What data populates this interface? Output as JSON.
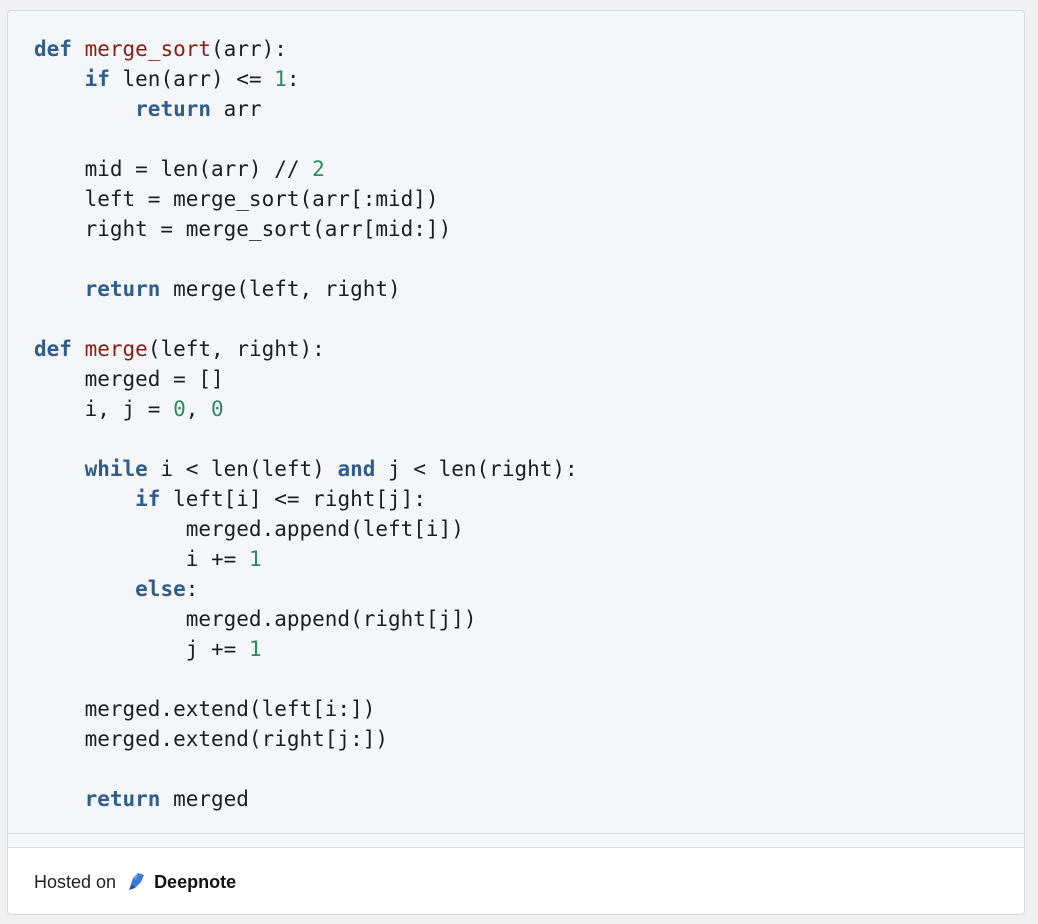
{
  "code": {
    "lines": [
      [
        [
          "kw",
          "def"
        ],
        [
          "t",
          " "
        ],
        [
          "fn",
          "merge_sort"
        ],
        [
          "t",
          "(arr):"
        ]
      ],
      [
        [
          "t",
          "    "
        ],
        [
          "kw",
          "if"
        ],
        [
          "t",
          " len(arr) <= "
        ],
        [
          "num",
          "1"
        ],
        [
          "t",
          ":"
        ]
      ],
      [
        [
          "t",
          "        "
        ],
        [
          "kw",
          "return"
        ],
        [
          "t",
          " arr"
        ]
      ],
      [
        [
          "t",
          ""
        ]
      ],
      [
        [
          "t",
          "    mid = len(arr) // "
        ],
        [
          "num",
          "2"
        ]
      ],
      [
        [
          "t",
          "    left = merge_sort(arr[:mid])"
        ]
      ],
      [
        [
          "t",
          "    right = merge_sort(arr[mid:])"
        ]
      ],
      [
        [
          "t",
          ""
        ]
      ],
      [
        [
          "t",
          "    "
        ],
        [
          "kw",
          "return"
        ],
        [
          "t",
          " merge(left, right)"
        ]
      ],
      [
        [
          "t",
          ""
        ]
      ],
      [
        [
          "kw",
          "def"
        ],
        [
          "t",
          " "
        ],
        [
          "fn",
          "merge"
        ],
        [
          "t",
          "(left, right):"
        ]
      ],
      [
        [
          "t",
          "    merged = []"
        ]
      ],
      [
        [
          "t",
          "    i, j = "
        ],
        [
          "num",
          "0"
        ],
        [
          "t",
          ", "
        ],
        [
          "num",
          "0"
        ]
      ],
      [
        [
          "t",
          ""
        ]
      ],
      [
        [
          "t",
          "    "
        ],
        [
          "kw",
          "while"
        ],
        [
          "t",
          " i < len(left) "
        ],
        [
          "kw",
          "and"
        ],
        [
          "t",
          " j < len(right):"
        ]
      ],
      [
        [
          "t",
          "        "
        ],
        [
          "kw",
          "if"
        ],
        [
          "t",
          " left[i] <= right[j]:"
        ]
      ],
      [
        [
          "t",
          "            merged.append(left[i])"
        ]
      ],
      [
        [
          "t",
          "            i += "
        ],
        [
          "num",
          "1"
        ]
      ],
      [
        [
          "t",
          "        "
        ],
        [
          "kw",
          "else"
        ],
        [
          "t",
          ":"
        ]
      ],
      [
        [
          "t",
          "            merged.append(right[j])"
        ]
      ],
      [
        [
          "t",
          "            j += "
        ],
        [
          "num",
          "1"
        ]
      ],
      [
        [
          "t",
          ""
        ]
      ],
      [
        [
          "t",
          "    merged.extend(left[i:])"
        ]
      ],
      [
        [
          "t",
          "    merged.extend(right[j:])"
        ]
      ],
      [
        [
          "t",
          ""
        ]
      ],
      [
        [
          "t",
          "    "
        ],
        [
          "kw",
          "return"
        ],
        [
          "t",
          " merged"
        ]
      ]
    ]
  },
  "footer": {
    "hosted_label": "Hosted on",
    "brand_name": "Deepnote",
    "logo_icon": "deepnote-logo-icon"
  },
  "colors": {
    "keyword": "#2f5d8c",
    "function": "#8a1d12",
    "number": "#2f8a5b",
    "code_bg": "#f4f6f9",
    "brand_blue": "#3a7bd5"
  }
}
